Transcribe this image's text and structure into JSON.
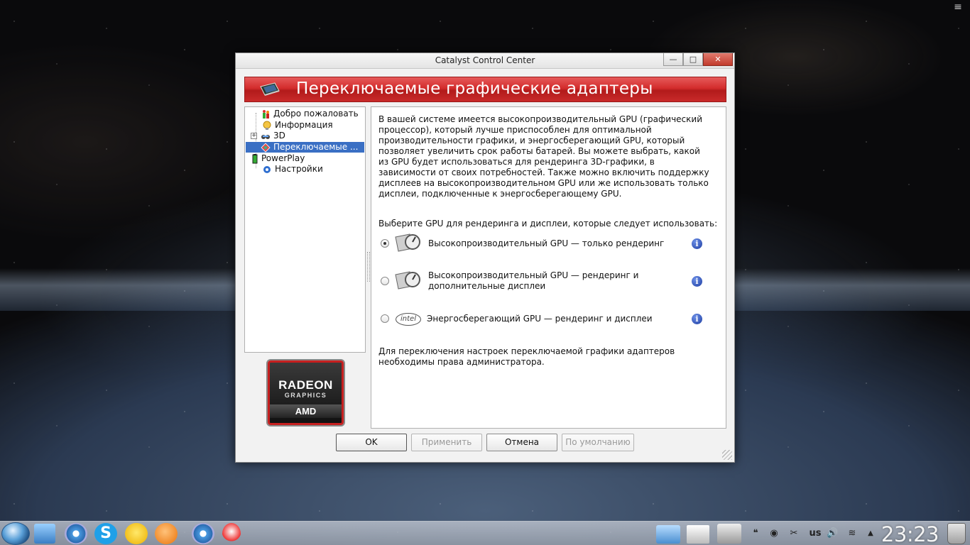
{
  "window": {
    "title": "Catalyst Control Center",
    "buttons": {
      "minimize": "—",
      "maximize": "□",
      "close": "✕"
    }
  },
  "banner": {
    "title": "Переключаемые графические адаптеры"
  },
  "tree": {
    "items": [
      {
        "label": "Добро пожаловать",
        "icon": "welcome-icon"
      },
      {
        "label": "Информация",
        "icon": "info-bulb-icon"
      },
      {
        "label": "3D",
        "icon": "3d-icon"
      },
      {
        "label": "Переключаемые ...",
        "icon": "switchable-graphics-icon"
      },
      {
        "label": "PowerPlay",
        "icon": "battery-icon"
      },
      {
        "label": "Настройки",
        "icon": "settings-icon"
      }
    ]
  },
  "logo": {
    "line1": "RADEON",
    "line2": "GRAPHICS",
    "line3": "AMD"
  },
  "content": {
    "description": "В вашей системе имеется высокопроизводительный GPU (графический процессор), который лучше приспособлен для оптимальной производительности графики, и энергосберегающий GPU, который позволяет увеличить срок работы батарей. Вы можете выбрать, какой из GPU будет использоваться для рендеринга 3D-графики, в зависимости от своих потребностей. Также можно включить поддержку дисплеев на высокопроизводительном GPU или же использовать только дисплеи, подключенные к энергосберегающему GPU.",
    "prompt": "Выберите GPU для рендеринга и дисплеи, которые следует использовать:",
    "options": [
      {
        "label": "Высокопроизводительный GPU — только рендеринг",
        "selected": true,
        "icon": "high-performance-gpu-icon"
      },
      {
        "label": "Высокопроизводительный GPU — рендеринг и дополнительные дисплеи",
        "selected": false,
        "icon": "high-performance-gpu-icon"
      },
      {
        "label": "Энергосберегающий GPU — рендеринг и дисплеи",
        "selected": false,
        "icon": "intel-logo-icon",
        "icon_text": "intel"
      }
    ],
    "note": "Для переключения настроек переключаемой графики адаптеров необходимы права администратора."
  },
  "buttons": {
    "ok": "OK",
    "apply": "Применить",
    "cancel": "Отмена",
    "defaults": "По умолчанию"
  },
  "taskbar": {
    "keyboard_layout": "us",
    "clock": "23:23"
  },
  "colors": {
    "banner_red": "#d32c2c",
    "selection_blue": "#3a6fc4",
    "info_blue": "#1f3fa3"
  }
}
